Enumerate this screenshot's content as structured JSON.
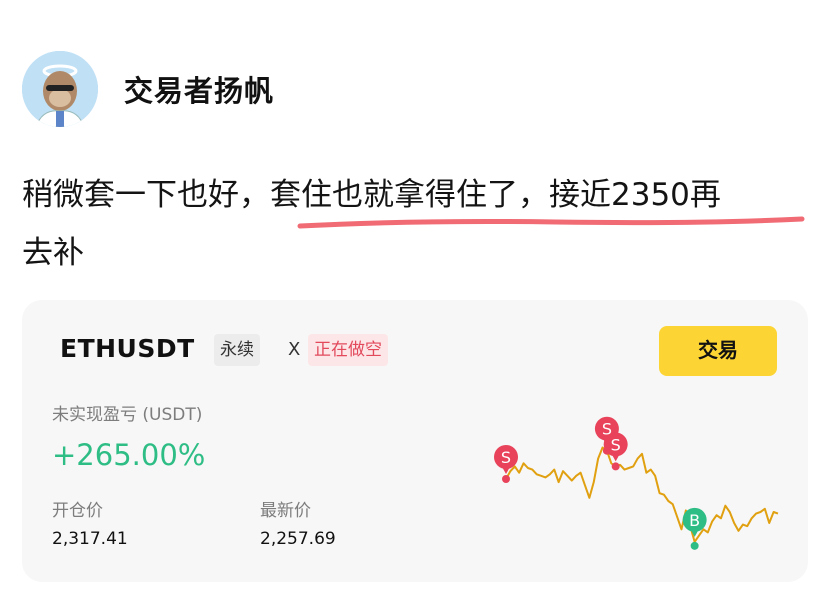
{
  "author": {
    "name": "交易者扬帆",
    "avatar_icon": "ape-avatar-icon"
  },
  "post": {
    "text_before": "稍微套一下也好，",
    "text_highlight": "套住也就拿得住了，接近2350再",
    "text_after": "去补"
  },
  "position_card": {
    "symbol": "ETHUSDT",
    "type_tag": "永续",
    "leverage": "X",
    "side_tag": "正在做空",
    "trade_button": "交易",
    "pnl_label": "未实现盈亏 (USDT)",
    "pnl_value": "+265.00%",
    "open_label": "开仓价",
    "open_value": "2,317.41",
    "last_label": "最新价",
    "last_value": "2,257.69"
  },
  "chart_data": {
    "type": "line",
    "x": [
      0,
      1,
      2,
      3,
      4,
      5,
      6,
      7,
      8,
      9,
      10,
      11,
      12,
      13,
      14,
      15,
      16,
      17,
      18,
      19,
      20,
      21,
      22,
      23,
      24,
      25,
      26,
      27,
      28,
      29,
      30,
      31,
      32,
      33,
      34,
      35,
      36,
      37,
      38,
      39,
      40,
      41,
      42,
      43,
      44,
      45,
      46,
      47,
      48,
      49,
      50,
      51,
      52,
      53,
      54,
      55,
      56,
      57,
      58,
      59,
      60,
      61,
      62
    ],
    "series": [
      {
        "values": [
          42,
          47,
          50,
          46,
          52,
          49,
          48,
          45,
          44,
          43,
          45,
          48,
          40,
          47,
          44,
          41,
          44,
          46,
          38,
          30,
          40,
          55,
          62,
          60,
          52,
          50,
          51,
          48,
          49,
          50,
          55,
          58,
          46,
          48,
          44,
          33,
          32,
          28,
          26,
          18,
          10,
          22,
          12,
          2,
          6,
          10,
          8,
          15,
          19,
          17,
          25,
          21,
          14,
          9,
          13,
          12,
          17,
          20,
          21,
          23,
          14,
          21,
          20
        ],
        "color": "#e0a010"
      }
    ],
    "markers": [
      {
        "x": 0,
        "label": "S",
        "side": "sell"
      },
      {
        "x": 23,
        "label": "S",
        "side": "sell"
      },
      {
        "x": 25,
        "label": "S",
        "side": "sell"
      },
      {
        "x": 43,
        "label": "B",
        "side": "buy"
      }
    ],
    "colors": {
      "sell": "#e8435a",
      "buy": "#2ebd85",
      "line": "#e0a010"
    },
    "xlabel": "",
    "ylabel": "",
    "grid": false
  },
  "colors": {
    "accent_yellow": "#fcd535",
    "profit_green": "#2ebd85",
    "short_red": "#e24a5c",
    "underline_red": "#f06b74"
  }
}
